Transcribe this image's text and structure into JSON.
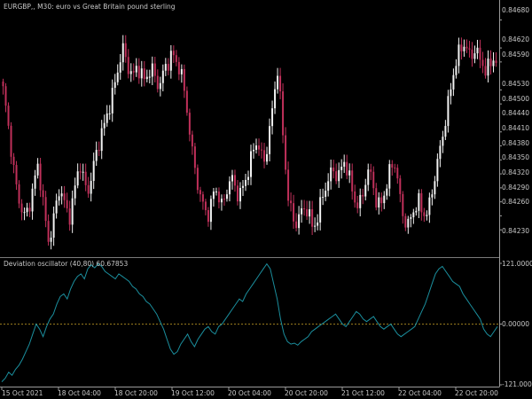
{
  "header": {
    "title": "EURGBP,, M30:  euro vs Great Britain pound sterling"
  },
  "indicator": {
    "title": "Deviation oscillator (40,80) 60.67853"
  },
  "price_axis": {
    "labels": [
      "0.84680",
      "0.84620",
      "0.84590",
      "0.84530",
      "0.84500",
      "0.84440",
      "0.84410",
      "0.84380",
      "0.84350",
      "0.84320",
      "0.84290",
      "0.84260",
      "0.84230"
    ]
  },
  "indicator_axis": {
    "labels": [
      "121.00000",
      "0.00000",
      "-121.00000"
    ]
  },
  "time_axis": {
    "labels": [
      "15 Oct 2021",
      "18 Oct 04:00",
      "18 Oct 20:00",
      "19 Oct 12:00",
      "20 Oct 04:00",
      "20 Oct 20:00",
      "21 Oct 12:00",
      "22 Oct 04:00",
      "22 Oct 20:00"
    ]
  },
  "colors": {
    "background": "#000000",
    "bull_candle": "#f2f2f2",
    "bear_candle": "#c0305a",
    "oscillator_line": "#1b8f9e",
    "zero_line": "#c9a227",
    "separator": "#7a7a7a",
    "text": "#c8c8c8"
  },
  "chart_data": [
    {
      "type": "candlestick",
      "title": "EURGBP,, M30:  euro vs Great Britain pound sterling",
      "ylim": [
        0.842,
        0.847
      ],
      "y_ticks": [
        0.8468,
        0.8462,
        0.8459,
        0.8453,
        0.845,
        0.8444,
        0.8441,
        0.8438,
        0.8435,
        0.8432,
        0.8429,
        0.8426,
        0.8423
      ],
      "x_tick_labels": [
        "15 Oct 2021",
        "18 Oct 04:00",
        "18 Oct 20:00",
        "19 Oct 12:00",
        "20 Oct 04:00",
        "20 Oct 20:00",
        "21 Oct 12:00",
        "22 Oct 04:00",
        "22 Oct 20:00"
      ],
      "close_path": [
        0.8453,
        0.8448,
        0.8442,
        0.8436,
        0.8431,
        0.8428,
        0.8426,
        0.8427,
        0.843,
        0.8434,
        0.8437,
        0.8431,
        0.8425,
        0.842,
        0.8424,
        0.8428,
        0.8432,
        0.843,
        0.8427,
        0.8426,
        0.843,
        0.8435,
        0.8437,
        0.8433,
        0.8431,
        0.8434,
        0.8438,
        0.8441,
        0.8444,
        0.8446,
        0.8449,
        0.8452,
        0.8455,
        0.8459,
        0.8462,
        0.8459,
        0.8457,
        0.8456,
        0.8458,
        0.8457,
        0.8455,
        0.8456,
        0.8458,
        0.8456,
        0.8454,
        0.8455,
        0.8458,
        0.8459,
        0.8461,
        0.8459,
        0.8458,
        0.8455,
        0.845,
        0.8444,
        0.8438,
        0.8434,
        0.843,
        0.8428,
        0.8426,
        0.8428,
        0.8432,
        0.8431,
        0.8428,
        0.843,
        0.8433,
        0.8434,
        0.8432,
        0.843,
        0.8432,
        0.8434,
        0.8437,
        0.844,
        0.8442,
        0.844,
        0.8437,
        0.8441,
        0.8446,
        0.8452,
        0.8458,
        0.8448,
        0.8438,
        0.843,
        0.8426,
        0.8424,
        0.8426,
        0.8427,
        0.8428,
        0.8426,
        0.8423,
        0.8425,
        0.8428,
        0.8431,
        0.8433,
        0.8435,
        0.8436,
        0.8434,
        0.8436,
        0.8438,
        0.8435,
        0.8432,
        0.8429,
        0.8428,
        0.843,
        0.8434,
        0.8436,
        0.8433,
        0.8429,
        0.8428,
        0.843,
        0.8433,
        0.8436,
        0.8438,
        0.8434,
        0.8428,
        0.8425,
        0.8424,
        0.8426,
        0.8428,
        0.8429,
        0.8427,
        0.8426,
        0.8428,
        0.8432,
        0.8436,
        0.844,
        0.8444,
        0.8448,
        0.8453,
        0.8457,
        0.846,
        0.8462,
        0.8463,
        0.8461,
        0.846,
        0.8462,
        0.846,
        0.8459,
        0.8457,
        0.8458,
        0.846,
        0.8459
      ],
      "y_ticks_oscillator": [
        121,
        0,
        -121
      ],
      "oscillator": {
        "name": "Deviation oscillator (40,80) 60.67853",
        "last_value": 60.67853,
        "ylim": [
          -121,
          121
        ],
        "values": [
          -115,
          -108,
          -96,
          -102,
          -90,
          -82,
          -70,
          -55,
          -40,
          -20,
          0,
          -10,
          -25,
          -5,
          10,
          20,
          40,
          55,
          60,
          50,
          70,
          85,
          95,
          100,
          90,
          110,
          118,
          112,
          120,
          115,
          105,
          100,
          95,
          90,
          100,
          95,
          90,
          85,
          75,
          70,
          60,
          55,
          45,
          40,
          30,
          20,
          5,
          -10,
          -30,
          -50,
          -60,
          -55,
          -40,
          -30,
          -20,
          -35,
          -45,
          -30,
          -20,
          -10,
          -5,
          -15,
          -20,
          -5,
          0,
          10,
          20,
          30,
          40,
          50,
          45,
          60,
          70,
          80,
          90,
          100,
          110,
          120,
          110,
          80,
          50,
          10,
          -20,
          -35,
          -40,
          -38,
          -42,
          -35,
          -30,
          -25,
          -15,
          -10,
          -5,
          0,
          5,
          10,
          15,
          20,
          10,
          0,
          -5,
          5,
          15,
          25,
          20,
          10,
          5,
          10,
          15,
          5,
          -5,
          -10,
          -5,
          0,
          -10,
          -20,
          -25,
          -20,
          -15,
          -10,
          -5,
          10,
          25,
          40,
          60,
          80,
          100,
          110,
          115,
          105,
          95,
          85,
          80,
          75,
          60,
          50,
          40,
          30,
          20,
          10,
          -10,
          -20,
          -25,
          -15,
          -5
        ]
      }
    }
  ]
}
